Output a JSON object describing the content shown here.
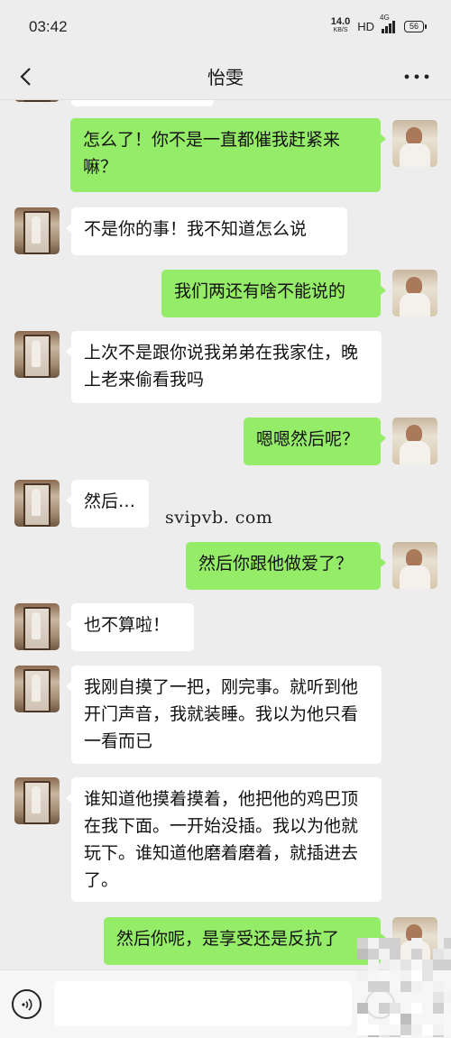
{
  "status_bar": {
    "time": "03:42",
    "net_speed_value": "14.0",
    "net_speed_unit": "KB/S",
    "hd_label": "HD",
    "network_type": "4G",
    "battery": "56"
  },
  "header": {
    "title": "怡雯"
  },
  "messages": [
    {
      "from": "self",
      "text": "怎么了！你不是一直都催我赶紧来嘛？"
    },
    {
      "from": "other",
      "text": "不是你的事！我不知道怎么说"
    },
    {
      "from": "self",
      "text": "我们两还有啥不能说的"
    },
    {
      "from": "other",
      "text": "上次不是跟你说我弟弟在我家住，晚上老来偷看我吗"
    },
    {
      "from": "self",
      "text": "嗯嗯然后呢？"
    },
    {
      "from": "other",
      "text": "然后…"
    },
    {
      "from": "self",
      "text": "然后你跟他做爱了？"
    },
    {
      "from": "other",
      "text": "也不算啦！"
    },
    {
      "from": "other",
      "text": "我刚自摸了一把，刚完事。就听到他开门声音，我就装睡。我以为他只看一看而已"
    },
    {
      "from": "other",
      "text": "谁知道他摸着摸着，他把他的鸡巴顶在我下面。一开始没插。我以为他就玩下。谁知道他磨着磨着，就插进去了。"
    },
    {
      "from": "self",
      "text": "然后你呢，是享受还是反抗了"
    }
  ],
  "watermark": "svipvb. com",
  "input": {
    "value": "",
    "placeholder": ""
  },
  "icons": {
    "back": "chevron-left-icon",
    "more": "more-dots-icon",
    "voice": "voice-icon",
    "emoji": "emoji-icon"
  },
  "colors": {
    "background": "#ededed",
    "self_bubble": "#95ec69",
    "other_bubble": "#ffffff"
  }
}
